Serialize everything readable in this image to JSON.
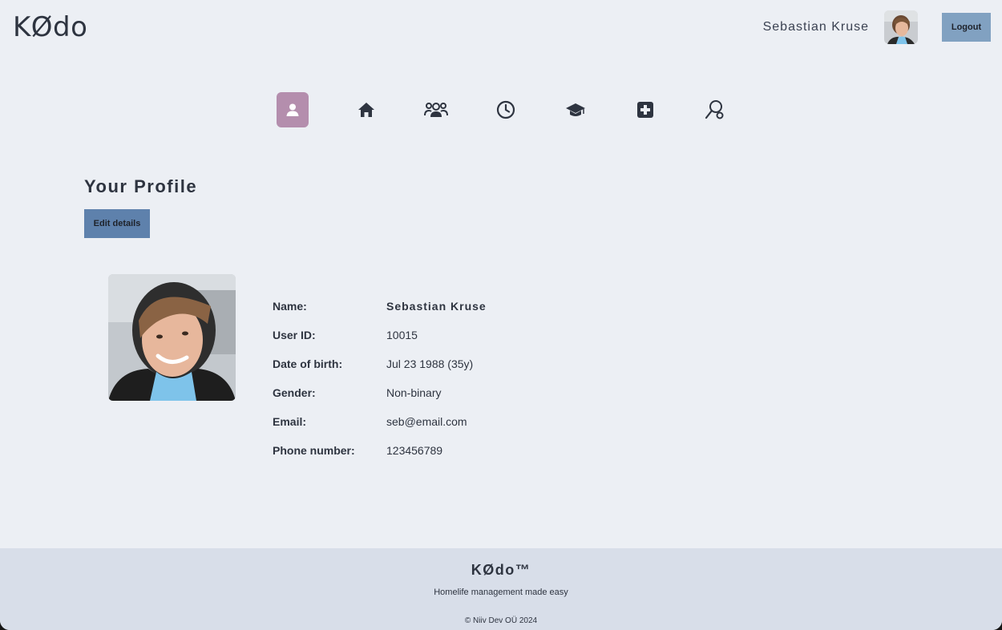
{
  "header": {
    "logo": "KØdo",
    "user_name": "Sebastian Kruse",
    "logout_label": "Logout"
  },
  "nav": {
    "items": [
      {
        "icon": "user-icon",
        "active": true
      },
      {
        "icon": "home-icon",
        "active": false
      },
      {
        "icon": "users-group-icon",
        "active": false
      },
      {
        "icon": "clock-icon",
        "active": false
      },
      {
        "icon": "graduation-cap-icon",
        "active": false
      },
      {
        "icon": "medical-plus-icon",
        "active": false
      },
      {
        "icon": "key-search-icon",
        "active": false
      }
    ]
  },
  "profile": {
    "title": "Your Profile",
    "edit_label": "Edit details",
    "fields": [
      {
        "label": "Name:",
        "value": "Sebastian Kruse"
      },
      {
        "label": "User ID:",
        "value": "10015"
      },
      {
        "label": "Date of birth:",
        "value": "Jul 23 1988 (35y)"
      },
      {
        "label": "Gender:",
        "value": "Non-binary"
      },
      {
        "label": "Email:",
        "value": "seb@email.com"
      },
      {
        "label": "Phone number:",
        "value": "123456789"
      }
    ]
  },
  "footer": {
    "brand": "KØdo™",
    "tagline": "Homelife management made easy",
    "copyright": "© Niiv Dev OÜ 2024"
  },
  "colors": {
    "background": "#eceff4",
    "footer_bg": "#d8dee9",
    "active_nav": "#b48ead",
    "logout_bg": "#81a1c1",
    "edit_bg": "#5e81ac",
    "text": "#2e3440"
  }
}
